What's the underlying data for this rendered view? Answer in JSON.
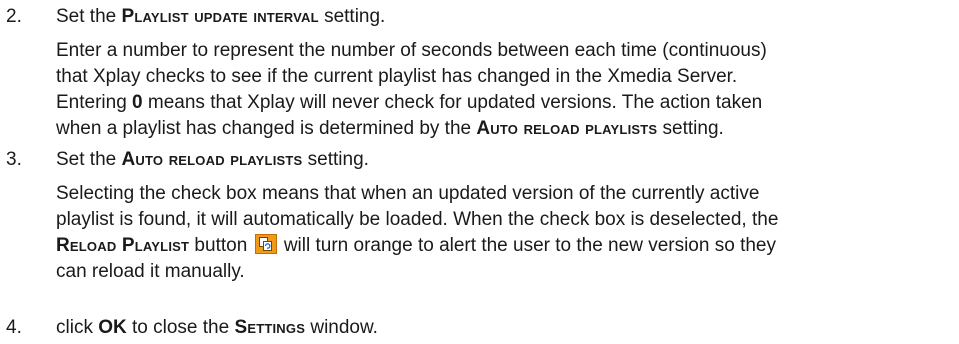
{
  "steps": [
    {
      "number": "2.",
      "instruction": {
        "pre": "Set the ",
        "setting": "Playlist update interval",
        "post": " setting."
      },
      "lines": [
        "Enter a number to represent the number of seconds between each time (continuous)",
        "that Xplay checks to see if the current playlist has changed in the Xmedia Server.",
        {
          "pre": "Entering ",
          "bold": "0",
          "post": " means that Xplay will never check for updated versions. The action taken"
        },
        {
          "pre": "when a playlist has changed is determined by the ",
          "setting": "Auto reload playlists",
          "post": " setting."
        }
      ]
    },
    {
      "number": "3.",
      "instruction": {
        "pre": "Set the ",
        "setting": "Auto reload playlists",
        "post": " setting."
      },
      "lines": [
        "Selecting the check box means that when an updated version of the currently active",
        "playlist is found, it will automatically be loaded. When the check box is deselected, the",
        {
          "setting": "Reload Playlist",
          "mid": " button ",
          "icon": "reload-playlist-icon",
          "post": " will turn orange to alert the user to the new version so they"
        },
        "can reload it manually."
      ]
    },
    {
      "number": "4.",
      "instruction": {
        "pre": "click ",
        "bold": "OK",
        "mid": " to close the ",
        "setting": "Settings",
        "post": " window."
      }
    }
  ],
  "colors": {
    "text": "#1a1a1a",
    "icon_fill": "#f19a1a"
  }
}
